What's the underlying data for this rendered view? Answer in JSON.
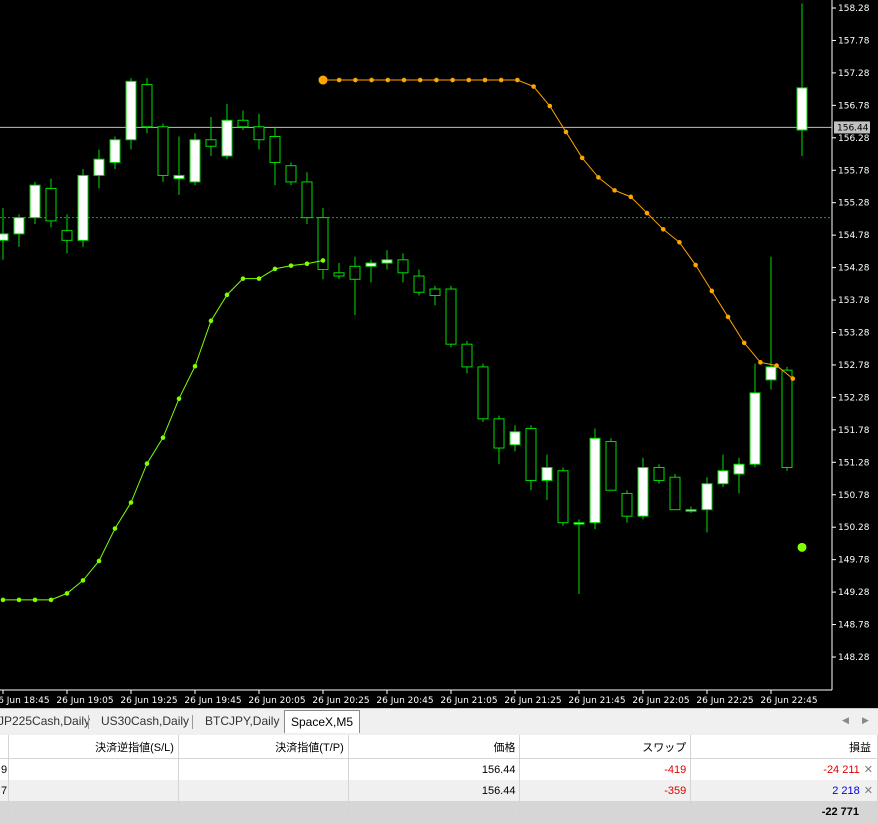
{
  "chart": {
    "current_price_label": "156.44",
    "y_axis_labels": [
      "158.28",
      "157.78",
      "157.28",
      "156.78",
      "156.28",
      "155.78",
      "155.28",
      "154.78",
      "154.28",
      "153.78",
      "153.28",
      "152.78",
      "152.28",
      "151.78",
      "151.28",
      "150.78",
      "150.28",
      "149.78",
      "149.28",
      "148.78",
      "148.28"
    ],
    "x_axis_labels": [
      "26 Jun 18:45",
      "26 Jun 19:05",
      "26 Jun 19:25",
      "26 Jun 19:45",
      "26 Jun 20:05",
      "26 Jun 20:25",
      "26 Jun 20:45",
      "26 Jun 21:05",
      "26 Jun 21:25",
      "26 Jun 21:45",
      "26 Jun 22:05",
      "26 Jun 22:25",
      "26 Jun 22:45"
    ],
    "colors": {
      "background": "#000000",
      "bull_body": "#ffffff",
      "candle_outline": "#00dd00",
      "green_indicator": "#7fff00",
      "orange_indicator": "#ffa500",
      "bid_line": "#c0c0c0",
      "dotted_line": "#00bb00"
    }
  },
  "chart_data": {
    "type": "candlestick",
    "symbol_timeframe": "SpaceX,M5",
    "ylim": [
      147.9,
      158.4
    ],
    "candles": [
      {
        "o": 154.7,
        "h": 155.2,
        "l": 154.4,
        "c": 154.8
      },
      {
        "o": 154.8,
        "h": 155.1,
        "l": 154.6,
        "c": 155.05
      },
      {
        "o": 155.05,
        "h": 155.6,
        "l": 154.95,
        "c": 155.55
      },
      {
        "o": 155.5,
        "h": 155.65,
        "l": 154.9,
        "c": 155.0
      },
      {
        "o": 154.85,
        "h": 155.1,
        "l": 154.5,
        "c": 154.7
      },
      {
        "o": 154.7,
        "h": 155.8,
        "l": 154.6,
        "c": 155.7
      },
      {
        "o": 155.7,
        "h": 156.1,
        "l": 155.5,
        "c": 155.95
      },
      {
        "o": 155.9,
        "h": 156.3,
        "l": 155.8,
        "c": 156.25
      },
      {
        "o": 156.25,
        "h": 157.2,
        "l": 156.1,
        "c": 157.15
      },
      {
        "o": 157.1,
        "h": 157.2,
        "l": 156.35,
        "c": 156.45
      },
      {
        "o": 156.45,
        "h": 156.5,
        "l": 155.6,
        "c": 155.7
      },
      {
        "o": 155.65,
        "h": 156.3,
        "l": 155.4,
        "c": 155.7
      },
      {
        "o": 155.6,
        "h": 156.35,
        "l": 155.55,
        "c": 156.25
      },
      {
        "o": 156.25,
        "h": 156.6,
        "l": 156.0,
        "c": 156.15
      },
      {
        "o": 156.0,
        "h": 156.8,
        "l": 155.95,
        "c": 156.55
      },
      {
        "o": 156.55,
        "h": 156.7,
        "l": 156.4,
        "c": 156.45
      },
      {
        "o": 156.45,
        "h": 156.65,
        "l": 156.1,
        "c": 156.25
      },
      {
        "o": 156.3,
        "h": 156.45,
        "l": 155.55,
        "c": 155.9
      },
      {
        "o": 155.85,
        "h": 155.9,
        "l": 155.55,
        "c": 155.6
      },
      {
        "o": 155.6,
        "h": 155.75,
        "l": 154.95,
        "c": 155.05
      },
      {
        "o": 155.05,
        "h": 155.2,
        "l": 154.1,
        "c": 154.25
      },
      {
        "o": 154.2,
        "h": 154.35,
        "l": 154.1,
        "c": 154.15
      },
      {
        "o": 154.3,
        "h": 154.45,
        "l": 153.55,
        "c": 154.1
      },
      {
        "o": 154.3,
        "h": 154.4,
        "l": 154.05,
        "c": 154.35
      },
      {
        "o": 154.35,
        "h": 154.55,
        "l": 154.25,
        "c": 154.4
      },
      {
        "o": 154.4,
        "h": 154.5,
        "l": 154.05,
        "c": 154.2
      },
      {
        "o": 154.15,
        "h": 154.25,
        "l": 153.85,
        "c": 153.9
      },
      {
        "o": 153.95,
        "h": 154.0,
        "l": 153.7,
        "c": 153.85
      },
      {
        "o": 153.95,
        "h": 154.0,
        "l": 153.05,
        "c": 153.1
      },
      {
        "o": 153.1,
        "h": 153.15,
        "l": 152.65,
        "c": 152.75
      },
      {
        "o": 152.75,
        "h": 152.8,
        "l": 151.9,
        "c": 151.95
      },
      {
        "o": 151.95,
        "h": 152.0,
        "l": 151.25,
        "c": 151.5
      },
      {
        "o": 151.55,
        "h": 151.85,
        "l": 151.45,
        "c": 151.75
      },
      {
        "o": 151.8,
        "h": 151.85,
        "l": 150.85,
        "c": 151.0
      },
      {
        "o": 151.0,
        "h": 151.4,
        "l": 150.7,
        "c": 151.2
      },
      {
        "o": 151.15,
        "h": 151.2,
        "l": 150.3,
        "c": 150.35
      },
      {
        "o": 150.35,
        "h": 150.4,
        "l": 149.25,
        "c": 150.35
      },
      {
        "o": 150.35,
        "h": 151.8,
        "l": 150.25,
        "c": 151.65
      },
      {
        "o": 151.6,
        "h": 151.65,
        "l": 150.85,
        "c": 150.85
      },
      {
        "o": 150.8,
        "h": 150.85,
        "l": 150.35,
        "c": 150.45
      },
      {
        "o": 150.45,
        "h": 151.35,
        "l": 150.4,
        "c": 151.2
      },
      {
        "o": 151.2,
        "h": 151.25,
        "l": 150.95,
        "c": 151.0
      },
      {
        "o": 151.05,
        "h": 151.1,
        "l": 150.55,
        "c": 150.55
      },
      {
        "o": 150.55,
        "h": 150.6,
        "l": 150.5,
        "c": 150.55
      },
      {
        "o": 150.55,
        "h": 151.05,
        "l": 150.2,
        "c": 150.95
      },
      {
        "o": 150.95,
        "h": 151.4,
        "l": 150.9,
        "c": 151.15
      },
      {
        "o": 151.1,
        "h": 151.35,
        "l": 150.8,
        "c": 151.25
      },
      {
        "o": 151.25,
        "h": 152.8,
        "l": 151.2,
        "c": 152.35
      },
      {
        "o": 152.55,
        "h": 154.45,
        "l": 152.4,
        "c": 152.75
      },
      {
        "o": 152.7,
        "h": 152.75,
        "l": 151.15,
        "c": 151.2
      },
      {
        "o": 156.4,
        "h": 158.35,
        "l": 156.0,
        "c": 157.05
      }
    ],
    "green_indicator": [
      149.16,
      149.16,
      149.16,
      149.16,
      149.26,
      149.46,
      149.76,
      150.26,
      150.66,
      151.26,
      151.66,
      152.26,
      152.76,
      153.46,
      153.86,
      154.11,
      154.11,
      154.26,
      154.31,
      154.34,
      154.39
    ],
    "green_dot_last": 149.97,
    "orange_indicator": [
      157.17,
      157.17,
      157.17,
      157.17,
      157.17,
      157.17,
      157.17,
      157.17,
      157.17,
      157.17,
      157.17,
      157.17,
      157.17,
      157.07,
      156.77,
      156.37,
      155.97,
      155.67,
      155.47,
      155.37,
      155.12,
      154.87,
      154.67,
      154.32,
      153.92,
      153.52,
      153.12,
      152.82,
      152.77,
      152.57
    ],
    "bid_price": 156.44,
    "dotted_level": 155.05
  },
  "tabs": {
    "items": [
      {
        "label": "JP225Cash,Daily",
        "active": false
      },
      {
        "label": "US30Cash,Daily",
        "active": false
      },
      {
        "label": "BTCJPY,Daily",
        "active": false
      },
      {
        "label": "SpaceX,M5",
        "active": true
      }
    ],
    "arrow_left": "◀",
    "arrow_right": "▶"
  },
  "positions": {
    "headers": [
      "",
      "決済逆指値(S/L)",
      "決済指値(T/P)",
      "価格",
      "スワップ",
      "損益"
    ],
    "rows": [
      {
        "id_tail": "9",
        "sl": "",
        "tp": "",
        "price": "156.44",
        "swap": "-419",
        "profit": "-24 211"
      },
      {
        "id_tail": "7",
        "sl": "",
        "tp": "",
        "price": "156.44",
        "swap": "-359",
        "profit": "2 218"
      }
    ],
    "total": "-22 771",
    "close_icon": "✕"
  }
}
